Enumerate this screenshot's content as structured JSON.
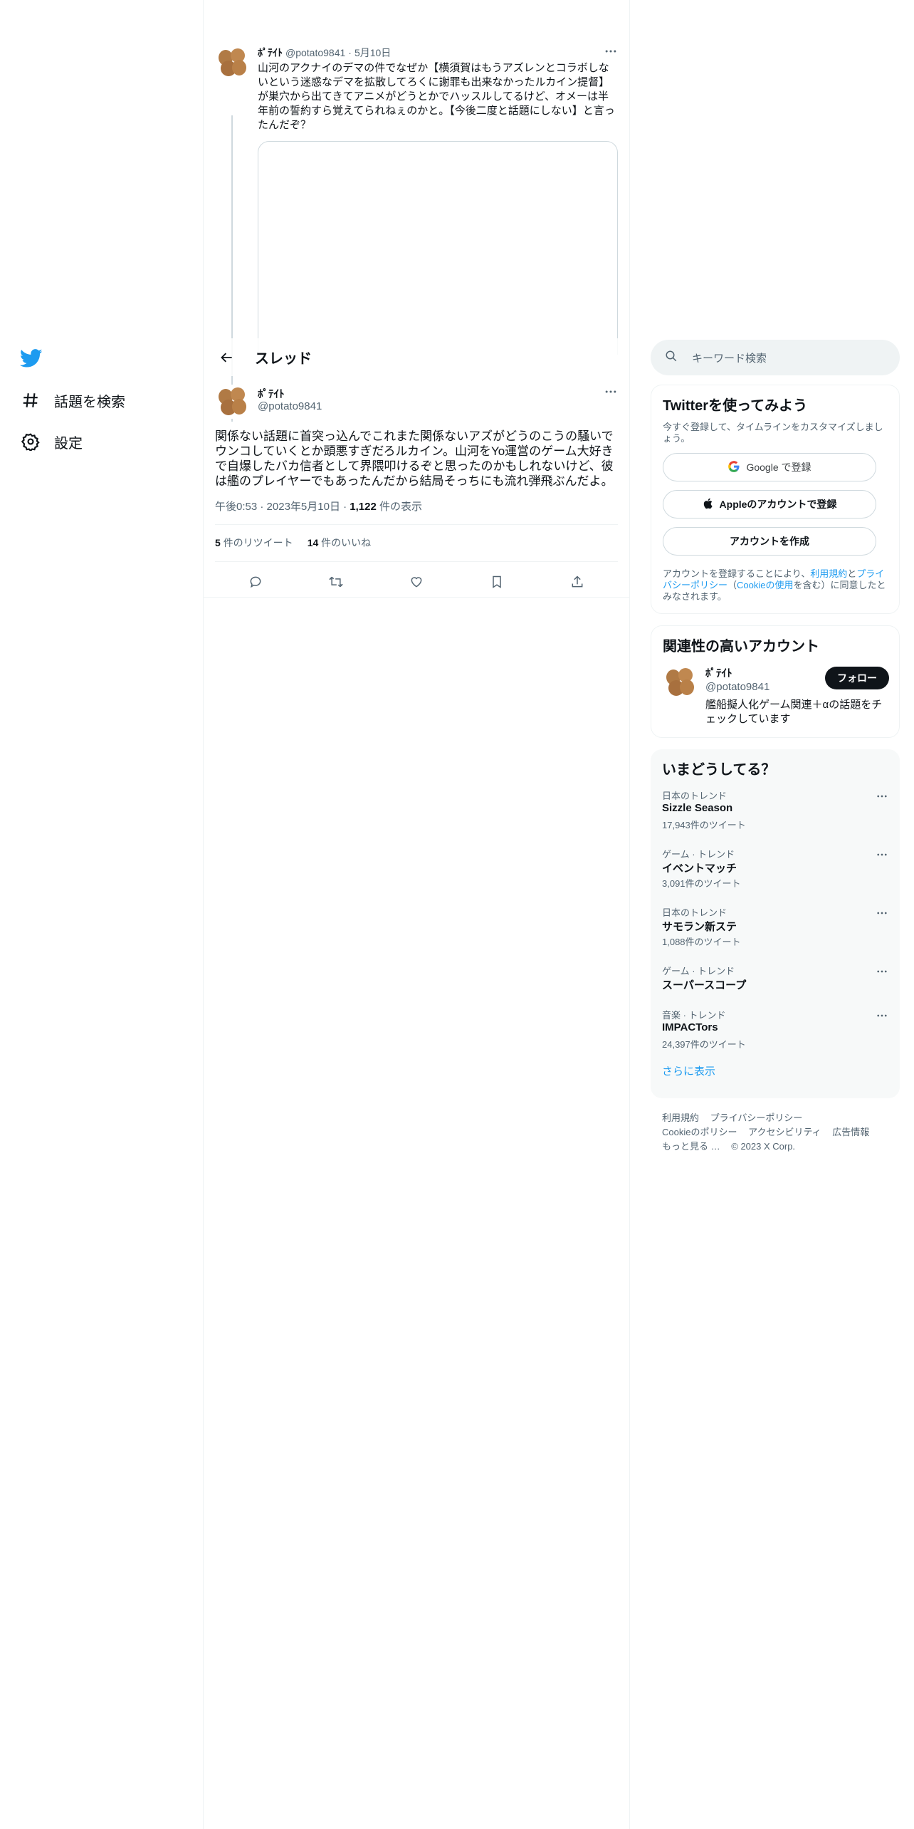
{
  "nav": {
    "explore_label": "話題を検索",
    "settings_label": "設定"
  },
  "parent_tweet": {
    "name": "ﾎﾟﾃｲﾄ",
    "handle": "@potato9841",
    "date": "5月10日",
    "text": "山河のアクナイのデマの件でなぜか【横須賀はもうアズレンとコラボしないという迷惑なデマを拡散してろくに謝罪も出来なかったルカイン提督】が巣穴から出てきてアニメがどうとかでハッスルしてるけど、オメーは半年前の誓約すら覚えてられねぇのかと。【今後二度と話題にしない】と言ったんだぞ？"
  },
  "header": {
    "title": "スレッド"
  },
  "tweet": {
    "name": "ﾎﾟﾃｲﾄ",
    "handle": "@potato9841",
    "text": "関係ない話題に首突っ込んでこれまた関係ないアズがどうのこうの騒いでウンコしていくとか頭悪すぎだろルカイン。山河をYo運営のゲーム大好きで自爆したバカ信者として界隈叩けるぞと思ったのかもしれないけど、彼は艦のプレイヤーでもあったんだから結局そっちにも流れ弾飛ぶんだよ。",
    "time": "午後0:53",
    "date": "2023年5月10日",
    "views_count": "1,122",
    "views_label": "件の表示",
    "retweets_count": "5",
    "retweets_label": "件のリツイート",
    "likes_count": "14",
    "likes_label": "件のいいね"
  },
  "search": {
    "placeholder": "キーワード検索"
  },
  "signup": {
    "title": "Twitterを使ってみよう",
    "subtitle": "今すぐ登録して、タイムラインをカスタマイズしましょう。",
    "google_label": "Google で登録",
    "apple_label": "Appleのアカウントで登録",
    "create_label": "アカウントを作成",
    "legal_prefix": "アカウントを登録することにより、",
    "terms_link": "利用規約",
    "and": "と",
    "privacy_link": "プライバシーポリシー",
    "paren_open": "（",
    "cookie_link": "Cookieの使用",
    "legal_suffix": "を含む）に同意したとみなされます。"
  },
  "related": {
    "title": "関連性の高いアカウント",
    "name": "ﾎﾟﾃｲﾄ",
    "handle": "@potato9841",
    "bio": "艦船擬人化ゲーム関連＋αの話題をチェックしています",
    "follow_label": "フォロー"
  },
  "trends": {
    "title": "いまどうしてる？",
    "items": [
      {
        "category": "日本のトレンド",
        "name": "Sizzle Season",
        "count": "17,943件のツイート"
      },
      {
        "category": "ゲーム · トレンド",
        "name": "イベントマッチ",
        "count": "3,091件のツイート"
      },
      {
        "category": "日本のトレンド",
        "name": "サモラン新ステ",
        "count": "1,088件のツイート"
      },
      {
        "category": "ゲーム · トレンド",
        "name": "スーパースコープ",
        "count": ""
      },
      {
        "category": "音楽 · トレンド",
        "name": "IMPACTors",
        "count": "24,397件のツイート"
      }
    ],
    "show_more": "さらに表示"
  },
  "footer": {
    "terms": "利用規約",
    "privacy": "プライバシーポリシー",
    "cookie": "Cookieのポリシー",
    "accessibility": "アクセシビリティ",
    "ads": "広告情報",
    "more": "もっと見る …",
    "copyright": "© 2023 X Corp."
  },
  "colors": {
    "brand": "#1d9bf0",
    "text": "#0f1419",
    "secondary": "#536471",
    "border": "#eff3f4"
  }
}
